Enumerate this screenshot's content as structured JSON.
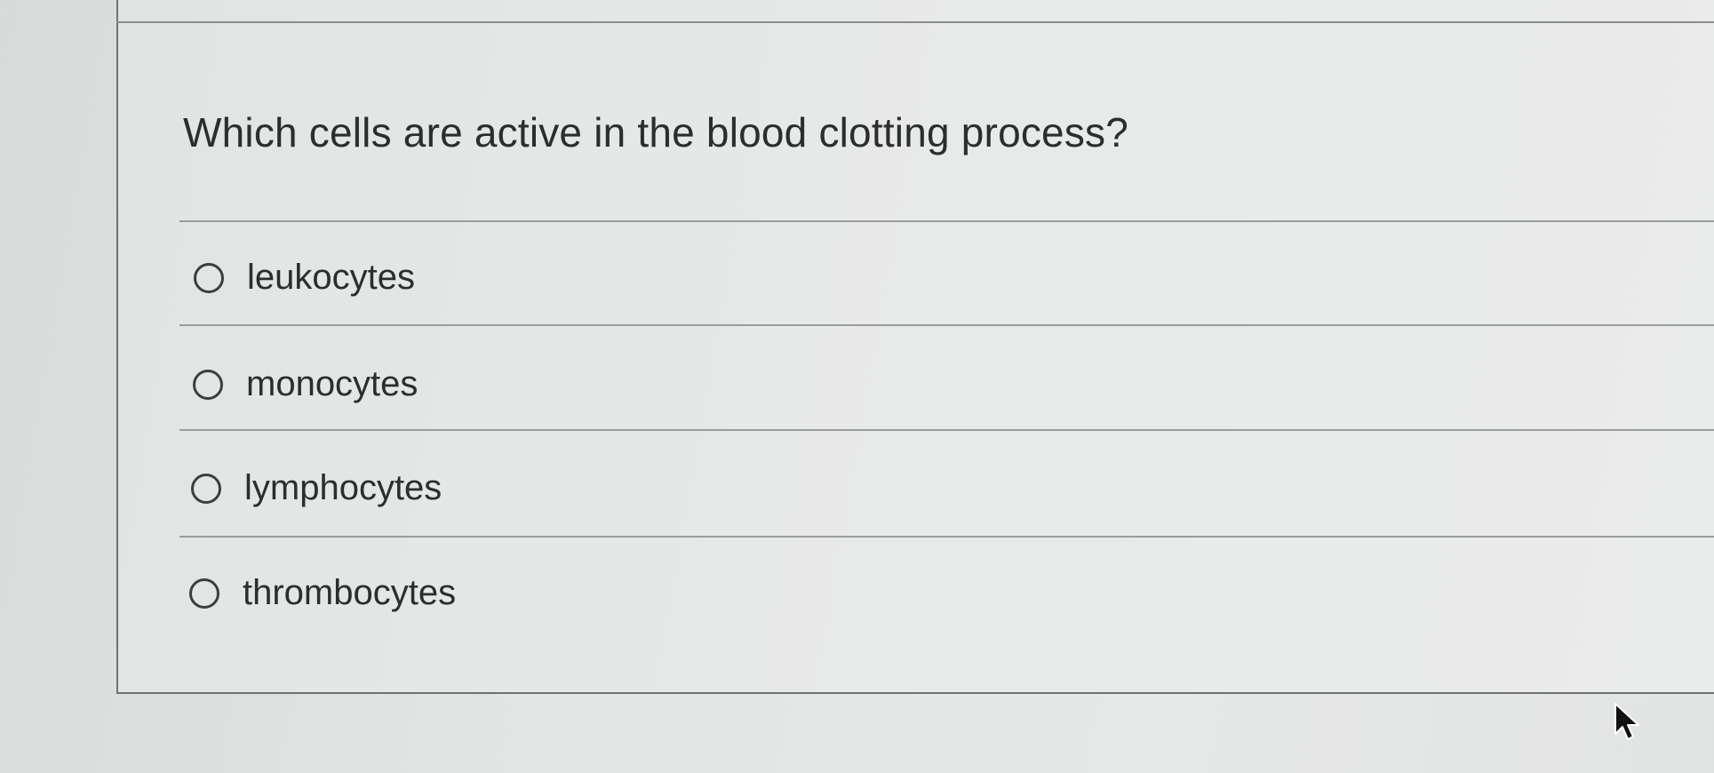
{
  "question": {
    "text": "Which cells are active in the blood clotting process?"
  },
  "options": [
    {
      "label": "leukocytes",
      "selected": false
    },
    {
      "label": "monocytes",
      "selected": false
    },
    {
      "label": "lymphocytes",
      "selected": false
    },
    {
      "label": "thrombocytes",
      "selected": false
    }
  ],
  "colors": {
    "text": "#2b2d2e",
    "radio_border": "#3b3d3e",
    "rule": "#9a9d9d",
    "card_border": "#6f7272"
  },
  "cursor": {
    "icon": "arrow-cursor-icon"
  }
}
